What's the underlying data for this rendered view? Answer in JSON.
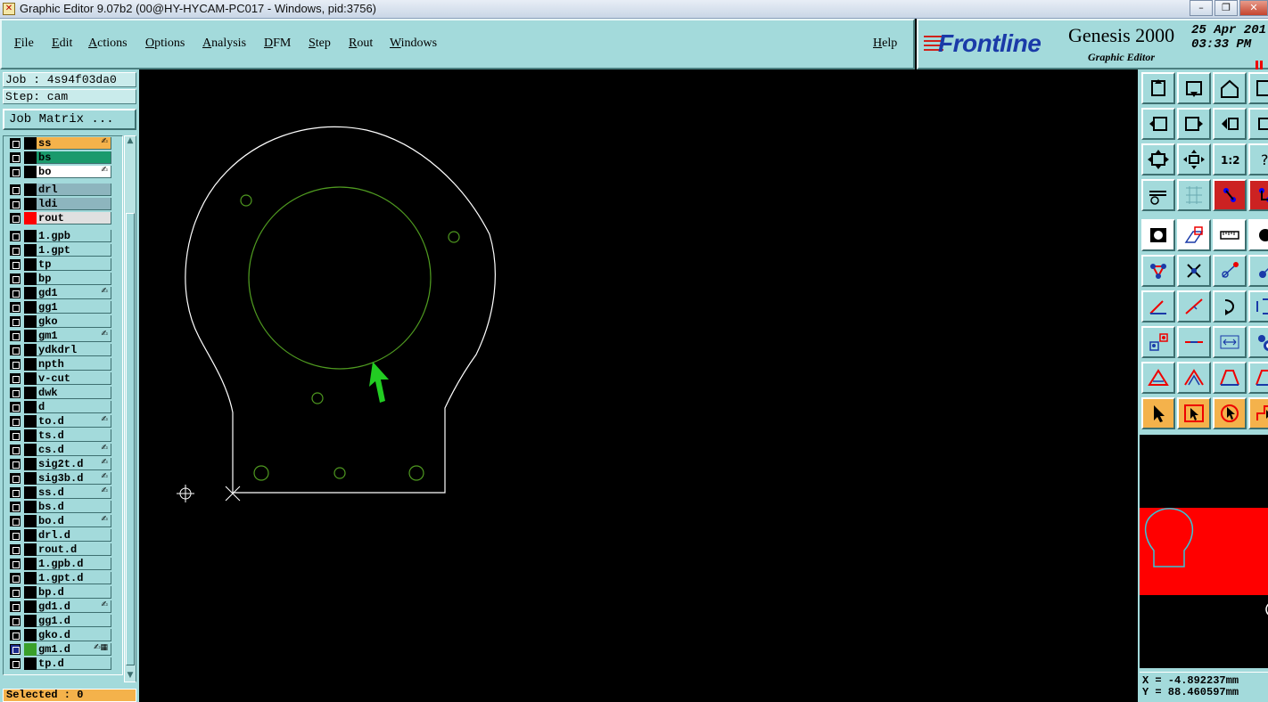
{
  "window": {
    "title": "Graphic Editor 9.07b2 (00@HY-HYCAM-PC017 - Windows, pid:3756)"
  },
  "menubar": {
    "items": [
      "File",
      "Edit",
      "Actions",
      "Options",
      "Analysis",
      "DFM",
      "Step",
      "Rout",
      "Windows"
    ],
    "help": "Help"
  },
  "brand": {
    "logo": "Frontline",
    "product": "Genesis 2000",
    "subtitle": "Graphic Editor",
    "date": "25 Apr 201",
    "time": "03:33 PM"
  },
  "job": {
    "job_label": "Job : 4s94f03da0",
    "step_label": "Step: cam",
    "matrix_button": "Job Matrix ..."
  },
  "layers": [
    {
      "name": "ss",
      "color": "#f4b24b",
      "mark": "✍"
    },
    {
      "name": "bs",
      "color": "#1a9a6c",
      "mark": ""
    },
    {
      "name": "bo",
      "color": "#ffffff",
      "mark": "✍"
    },
    {
      "name": "drl",
      "color": "#8db5be",
      "mark": ""
    },
    {
      "name": "ldi",
      "color": "#8db5be",
      "mark": ""
    },
    {
      "name": "rout",
      "color": "#e0e0e0",
      "mark": "",
      "swatch": "#ff0000"
    },
    {
      "name": "1.gpb",
      "color": "",
      "mark": ""
    },
    {
      "name": "1.gpt",
      "color": "",
      "mark": ""
    },
    {
      "name": "tp",
      "color": "",
      "mark": ""
    },
    {
      "name": "bp",
      "color": "",
      "mark": ""
    },
    {
      "name": "gd1",
      "color": "",
      "mark": "✍"
    },
    {
      "name": "gg1",
      "color": "",
      "mark": ""
    },
    {
      "name": "gko",
      "color": "",
      "mark": ""
    },
    {
      "name": "gm1",
      "color": "",
      "mark": "✍"
    },
    {
      "name": "ydkdrl",
      "color": "",
      "mark": ""
    },
    {
      "name": "npth",
      "color": "",
      "mark": ""
    },
    {
      "name": "v-cut",
      "color": "",
      "mark": ""
    },
    {
      "name": "dwk",
      "color": "",
      "mark": ""
    },
    {
      "name": "d",
      "color": "",
      "mark": ""
    },
    {
      "name": "to.d",
      "color": "",
      "mark": "✍"
    },
    {
      "name": "ts.d",
      "color": "",
      "mark": ""
    },
    {
      "name": "cs.d",
      "color": "",
      "mark": "✍"
    },
    {
      "name": "sig2t.d",
      "color": "",
      "mark": "✍"
    },
    {
      "name": "sig3b.d",
      "color": "",
      "mark": "✍"
    },
    {
      "name": "ss.d",
      "color": "",
      "mark": "✍"
    },
    {
      "name": "bs.d",
      "color": "",
      "mark": ""
    },
    {
      "name": "bo.d",
      "color": "",
      "mark": "✍"
    },
    {
      "name": "drl.d",
      "color": "",
      "mark": ""
    },
    {
      "name": "rout.d",
      "color": "",
      "mark": ""
    },
    {
      "name": "1.gpb.d",
      "color": "",
      "mark": ""
    },
    {
      "name": "1.gpt.d",
      "color": "",
      "mark": ""
    },
    {
      "name": "bp.d",
      "color": "",
      "mark": ""
    },
    {
      "name": "gd1.d",
      "color": "",
      "mark": "✍"
    },
    {
      "name": "gg1.d",
      "color": "",
      "mark": ""
    },
    {
      "name": "gko.d",
      "color": "",
      "mark": ""
    },
    {
      "name": "gm1.d",
      "color": "",
      "mark": "✍▦",
      "swatch": "#3aa02a",
      "checked": true
    },
    {
      "name": "tp.d",
      "color": "",
      "mark": ""
    }
  ],
  "status": {
    "selected": "Selected : 0"
  },
  "coords": {
    "x": "X = -4.892237mm",
    "y": "Y = 88.460597mm"
  },
  "colors": {
    "panel_bg": "#a3dadb",
    "outline": "#ffffff",
    "feature": "#4f9a20",
    "cursor_arrow": "#22cc22",
    "overview_bg": "#ff0000",
    "overview_outline": "#36c6d8"
  },
  "toolbar_icons": [
    "toolbox-icon",
    "display-icon",
    "home-icon",
    "layers-icon",
    "zoom-left-icon",
    "zoom-right-icon",
    "undo-icon",
    "pan-icon",
    "fit-screen-icon",
    "zoom-in-icon",
    "scale-1-2-icon",
    "help-icon",
    "measure-icon",
    "grid-icon",
    "snap-icon",
    "snap2-icon",
    "fill-icon",
    "polygon-icon",
    "ruler-icon",
    "dot-icon",
    "nodes-icon",
    "cross-icon",
    "line-point-icon",
    "pad-icon",
    "angle-icon",
    "diagonal-icon",
    "arc-icon",
    "bracket-icon",
    "pad-square-icon",
    "move-line-icon",
    "dimension-icon",
    "circle-icon",
    "triangle-red-icon",
    "triangle-blue-icon",
    "trapezoid-icon",
    "trapezoid2-icon",
    "select-arrow-icon",
    "select-box-icon",
    "select-polygon-icon",
    "select-step-icon"
  ]
}
